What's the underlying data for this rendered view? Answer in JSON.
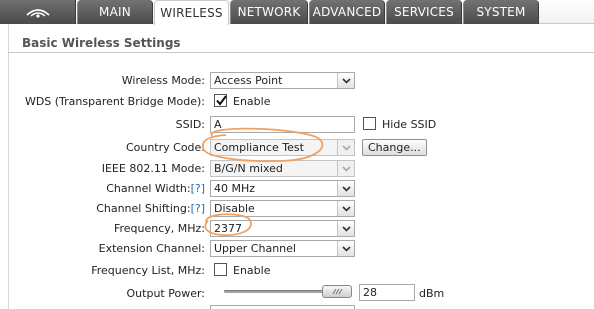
{
  "tabs": [
    {
      "label": "MAIN",
      "active": false
    },
    {
      "label": "WIRELESS",
      "active": true
    },
    {
      "label": "NETWORK",
      "active": false
    },
    {
      "label": "ADVANCED",
      "active": false
    },
    {
      "label": "SERVICES",
      "active": false
    },
    {
      "label": "SYSTEM",
      "active": false
    }
  ],
  "logo_icon": "ubiquiti-logo-icon",
  "section_title": "Basic Wireless Settings",
  "form": {
    "wireless_mode": {
      "label": "Wireless Mode:",
      "value": "Access Point"
    },
    "wds": {
      "label": "WDS (Transparent Bridge Mode):",
      "checked": true,
      "option_label": "Enable"
    },
    "ssid": {
      "label": "SSID:",
      "value": "A",
      "hide_label": "Hide SSID",
      "hide_checked": false
    },
    "country_code": {
      "label": "Country Code:",
      "value": "Compliance Test",
      "button": "Change..."
    },
    "ieee_mode": {
      "label": "IEEE 802.11 Mode:",
      "value": "B/G/N mixed"
    },
    "channel_width": {
      "label": "Channel Width:",
      "help": "[?]",
      "value": "40 MHz"
    },
    "channel_shifting": {
      "label": "Channel Shifting:",
      "help": "[?]",
      "value": "Disable"
    },
    "frequency": {
      "label": "Frequency, MHz:",
      "value": "2377"
    },
    "extension_channel": {
      "label": "Extension Channel:",
      "value": "Upper Channel"
    },
    "frequency_list": {
      "label": "Frequency List, MHz:",
      "checked": false,
      "option_label": "Enable"
    },
    "output_power": {
      "label": "Output Power:",
      "value": "28",
      "unit": "dBm"
    }
  },
  "colors": {
    "annotation": "#f0a060",
    "help_link": "#2a6bb8",
    "tab_dark": "#555555"
  }
}
